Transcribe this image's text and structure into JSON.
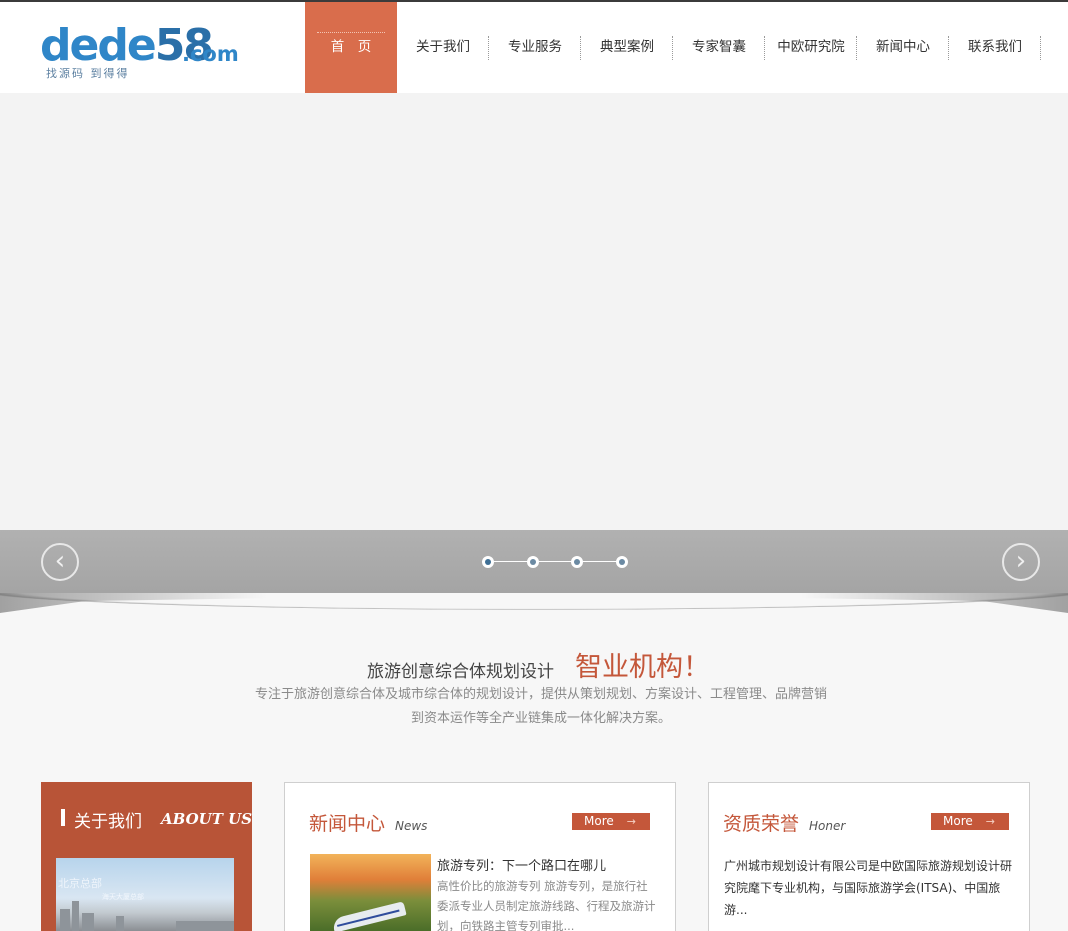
{
  "logo": {
    "main": "dede",
    "num": "58",
    "com": ".com",
    "tagline": "找源码 到得得"
  },
  "nav": {
    "items": [
      {
        "label": "首　页",
        "active": true
      },
      {
        "label": "关于我们"
      },
      {
        "label": "专业服务"
      },
      {
        "label": "典型案例"
      },
      {
        "label": "专家智囊"
      },
      {
        "label": "中欧研究院"
      },
      {
        "label": "新闻中心"
      },
      {
        "label": "联系我们"
      }
    ]
  },
  "slider": {
    "prev_icon": "chevron-left-icon",
    "next_icon": "chevron-right-icon",
    "prev_glyph": "‹",
    "next_glyph": "›",
    "dot_count": 4,
    "active_dot": 1
  },
  "intro": {
    "title": "旅游创意综合体规划设计",
    "strong": "智业机构！",
    "desc": "专注于旅游创意综合体及城市综合体的规划设计，提供从策划规划、方案设计、工程管理、品牌营销到资本运作等全产业链集成一体化解决方案。"
  },
  "about": {
    "title": "关于我们",
    "title_en": "ABOUT US",
    "img_caption": "北京总部",
    "img_sub": "海天大厦总部"
  },
  "news": {
    "title": "新闻中心",
    "title_en": "News",
    "more": "More",
    "more_arrow": "→",
    "item_title": "旅游专列：下一个路口在哪儿",
    "item_desc": "高性价比的旅游专列 旅游专列，是旅行社委派专业人员制定旅游线路、行程及旅游计划，向铁路主管专列审批..."
  },
  "honor": {
    "title": "资质荣誉",
    "title_en": "Honer",
    "more": "More",
    "more_arrow": "→",
    "text": "广州城市规划设计有限公司是中欧国际旅游规划设计研究院麾下专业机构，与国际旅游学会(ITSA)、中国旅游..."
  },
  "colors": {
    "accent": "#d96d4c",
    "accent_dark": "#c4573a",
    "about_bg": "#b85437",
    "logo_blue": "#2f86c8"
  }
}
